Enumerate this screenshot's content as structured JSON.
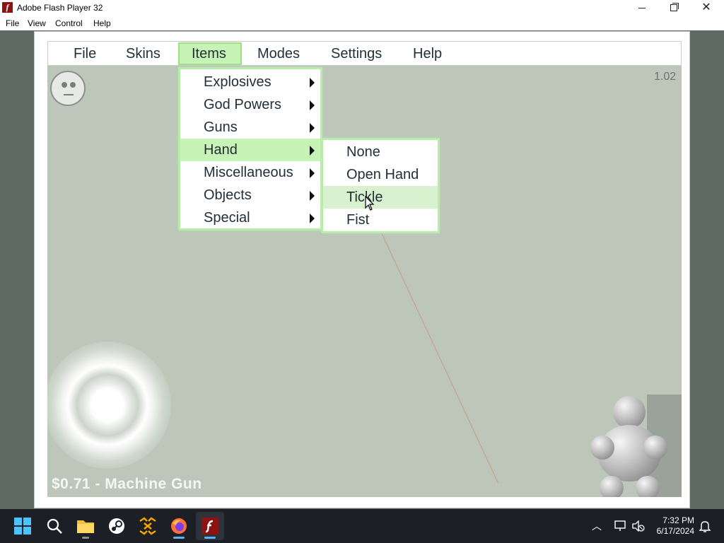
{
  "window": {
    "title": "Adobe Flash Player 32",
    "menu": [
      "File",
      "View",
      "Control",
      "Help"
    ]
  },
  "game": {
    "menu": [
      "File",
      "Skins",
      "Items",
      "Modes",
      "Settings",
      "Help"
    ],
    "active_menu": "Items",
    "version": "1.02",
    "status": "$0.71  -  Machine Gun"
  },
  "items_menu": {
    "items": [
      "Explosives",
      "God Powers",
      "Guns",
      "Hand",
      "Miscellaneous",
      "Objects",
      "Special"
    ],
    "highlighted": "Hand"
  },
  "hand_submenu": {
    "items": [
      "None",
      "Open Hand",
      "Tickle",
      "Fist"
    ],
    "hovered": "Tickle"
  },
  "taskbar": {
    "time": "7:32 PM",
    "date": "6/17/2024",
    "apps": [
      "windows-start",
      "search",
      "file-explorer",
      "steam",
      "app",
      "firefox",
      "flash-player"
    ]
  },
  "colors": {
    "stage": "#bcc7ba",
    "menu_highlight": "#c8f3b7",
    "menu_glow": "#b7eda6",
    "taskbar": "#1c2026"
  }
}
